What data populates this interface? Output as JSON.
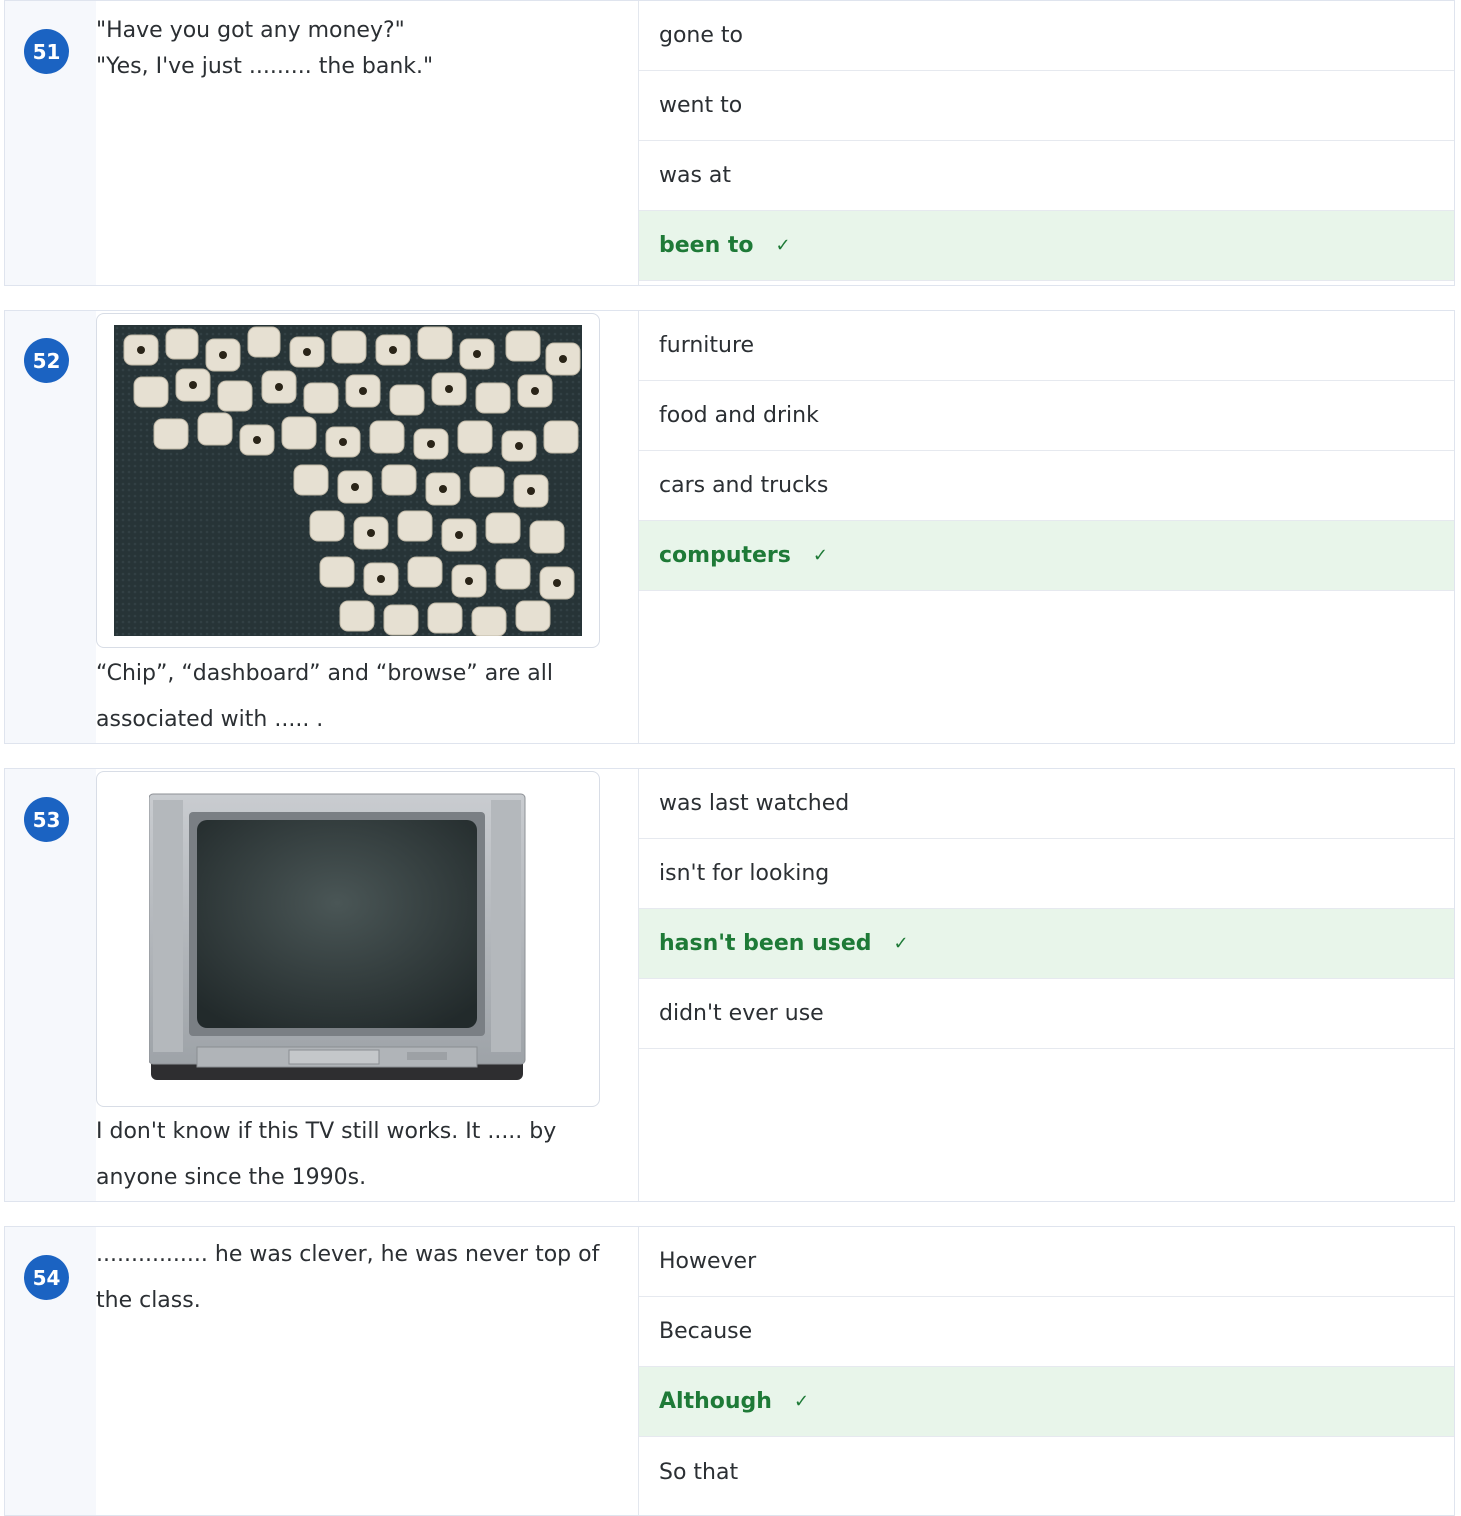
{
  "questions": [
    {
      "number": "51",
      "lines": [
        "\"Have you got any money?\"",
        "\"Yes, I've just ......... the bank.\""
      ],
      "options": [
        "gone to",
        "went to",
        "was at",
        "been to"
      ],
      "correct_index": 3
    },
    {
      "number": "52",
      "image": "wooden-letter-beads-image",
      "text": "“Chip”, “dashboard” and “browse” are all associated with ..... .",
      "options": [
        "furniture",
        "food and drink",
        "cars and trucks",
        "computers"
      ],
      "correct_index": 3
    },
    {
      "number": "53",
      "image": "old-crt-television-image",
      "text": "I don't know if this TV still works. It ..... by anyone since the 1990s.",
      "options": [
        "was last watched",
        "isn't for looking",
        "hasn't been used",
        "didn't ever use"
      ],
      "correct_index": 2
    },
    {
      "number": "54",
      "text": "................ he was clever, he was never top of the class.",
      "options": [
        "However",
        "Because",
        "Although",
        "So that"
      ],
      "correct_index": 2
    }
  ],
  "check_mark": "✓",
  "colors": {
    "badge": "#1b63c2",
    "correct_bg": "#e8f5ea",
    "correct_text": "#1e7a37"
  }
}
